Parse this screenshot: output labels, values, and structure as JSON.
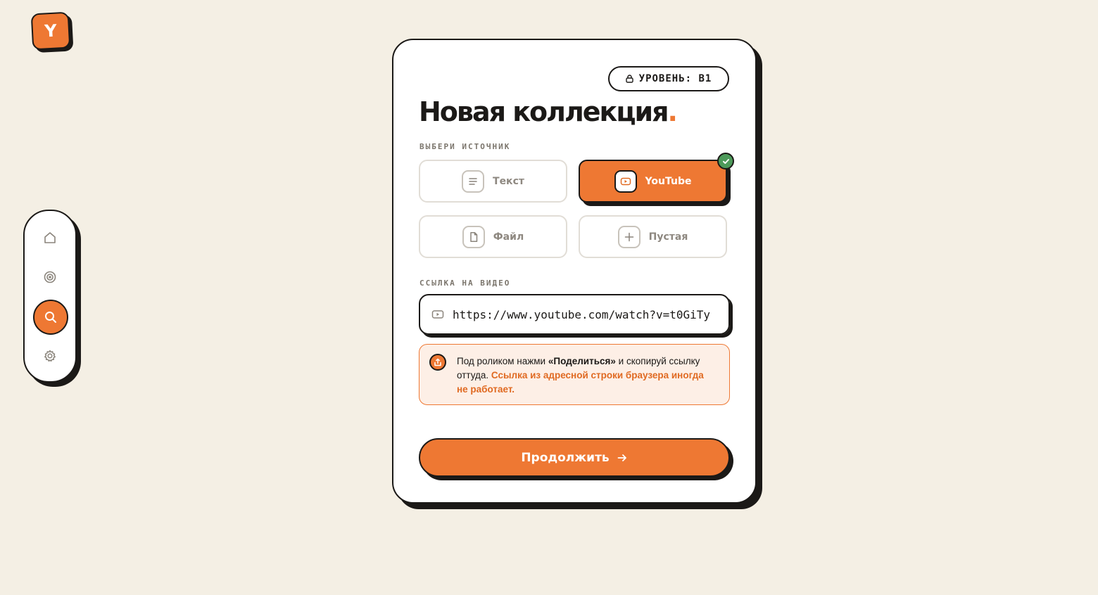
{
  "app": {
    "logo_letter": "Y"
  },
  "sidenav": {
    "items": [
      {
        "name": "home",
        "icon": "home-icon",
        "active": false
      },
      {
        "name": "target",
        "icon": "target-icon",
        "active": false
      },
      {
        "name": "search",
        "icon": "search-icon",
        "active": true
      },
      {
        "name": "settings",
        "icon": "gear-icon",
        "active": false
      }
    ]
  },
  "card": {
    "level_badge": "УРОВЕНЬ: B1",
    "title": "Новая коллекция",
    "title_dot": ".",
    "source_label": "ВЫБЕРИ ИСТОЧНИК",
    "sources": [
      {
        "label": "Текст",
        "icon": "text-lines-icon",
        "selected": false
      },
      {
        "label": "YouTube",
        "icon": "youtube-icon",
        "selected": true
      },
      {
        "label": "Файл",
        "icon": "file-icon",
        "selected": false
      },
      {
        "label": "Пустая",
        "icon": "plus-icon",
        "selected": false
      }
    ],
    "video_label": "ССЫЛКА НА ВИДЕО",
    "video_url": "https://www.youtube.com/watch?v=t0GiTy",
    "hint": {
      "prefix": "Под роликом нажми ",
      "bold": "«Поделиться»",
      "middle": " и скопируй ссылку оттуда. ",
      "warning": "Ссылка из адресной строки браузера иногда не работает."
    },
    "continue_label": "Продолжить"
  },
  "colors": {
    "accent": "#ee7833",
    "ink": "#1b1917",
    "background": "#f4efe4",
    "success": "#4d9a5a",
    "hint_bg": "#fdefe6"
  }
}
